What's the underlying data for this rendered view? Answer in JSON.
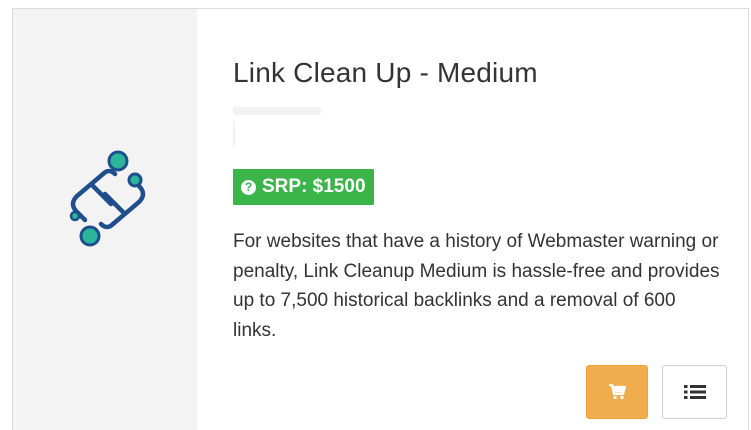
{
  "product": {
    "title": "Link Clean Up - Medium",
    "srp_label": "SRP: $1500",
    "description": "For websites that have a history of Webmaster warning or penalty, Link Cleanup Medium is hassle-free and provides up to 7,500 historical backlinks and a removal of 600 links."
  },
  "icons": {
    "product_icon": "broken-chain-link-icon",
    "help_icon": "question-circle-icon",
    "cart_icon": "shopping-cart-icon",
    "list_icon": "list-icon"
  },
  "colors": {
    "badge_green": "#3bb44a",
    "cart_orange": "#f0ad4e",
    "icon_blue": "#1f4e8c",
    "icon_teal": "#2bb59a"
  }
}
